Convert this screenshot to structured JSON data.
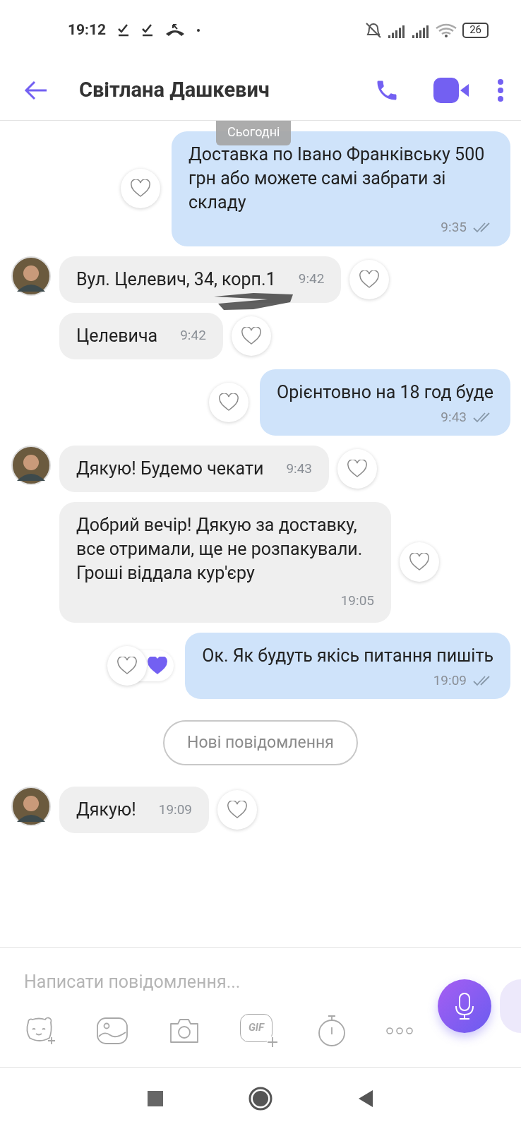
{
  "status_bar": {
    "time": "19:12",
    "battery": "26"
  },
  "header": {
    "title": "Світлана Дашкевич"
  },
  "date_chip": "Сьогодні",
  "messages": [
    {
      "kind": "outgoing",
      "text": "Доставка по Івано Франківську 500 грн або можете самі забрати зі складу",
      "time": "9:35",
      "liked": false
    },
    {
      "kind": "incoming",
      "avatar": true,
      "text": "Вул. Целевич, 34, корп.1",
      "time": "9:42",
      "time_inline": true,
      "scribbled": true
    },
    {
      "kind": "incoming",
      "avatar": false,
      "text": "Целевича",
      "time": "9:42",
      "time_inline": true,
      "scribbled": false
    },
    {
      "kind": "outgoing",
      "text": "Орієнтовно на 18 год буде",
      "time": "9:43",
      "liked": false
    },
    {
      "kind": "incoming",
      "avatar": true,
      "text": "Дякую! Будемо чекати",
      "time": "9:43",
      "time_inline": true,
      "scribbled": false
    },
    {
      "kind": "incoming",
      "avatar": false,
      "text": "Добрий вечір! Дякую за доставку, все отримали, ще не розпакували. Гроші віддала кур'єру",
      "time": "19:05",
      "time_inline": false,
      "scribbled": false
    },
    {
      "kind": "outgoing",
      "text": "Ок. Як будуть якісь питання пишіть",
      "time": "19:09",
      "liked": true
    },
    {
      "kind": "divider",
      "text": "Нові повідомлення"
    },
    {
      "kind": "incoming",
      "avatar": true,
      "text": "Дякую!",
      "time": "19:09",
      "time_inline": true,
      "scribbled": false
    }
  ],
  "composer": {
    "placeholder": "Написати повідомлення...",
    "gif_label": "GIF"
  }
}
